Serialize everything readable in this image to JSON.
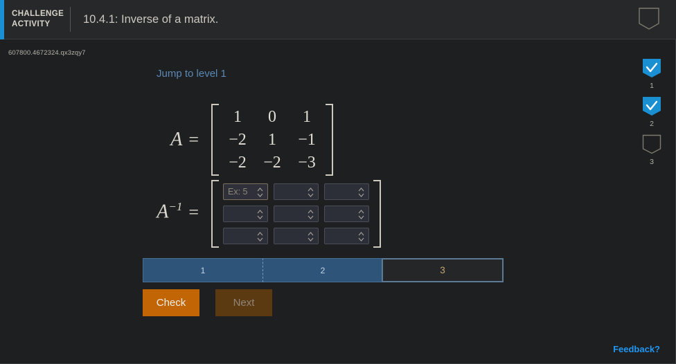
{
  "header": {
    "activity_label_line1": "CHALLENGE",
    "activity_label_line2": "ACTIVITY",
    "title": "10.4.1: Inverse of a matrix.",
    "shield_icon": "shield-outline-icon"
  },
  "content": {
    "question_id": "607800.4672324.qx3zqy7",
    "jump_link": "Jump to level 1"
  },
  "matrix_a": {
    "label": "A",
    "equals": "=",
    "rows": [
      [
        "1",
        "0",
        "1"
      ],
      [
        "−2",
        "1",
        "−1"
      ],
      [
        "−2",
        "−2",
        "−3"
      ]
    ]
  },
  "matrix_inverse": {
    "label": "A",
    "exponent": "−1",
    "equals": "=",
    "cells": [
      {
        "value": "",
        "placeholder": "Ex: 5",
        "focused": true
      },
      {
        "value": "",
        "placeholder": "",
        "focused": false
      },
      {
        "value": "",
        "placeholder": "",
        "focused": false
      },
      {
        "value": "",
        "placeholder": "",
        "focused": false
      },
      {
        "value": "",
        "placeholder": "",
        "focused": false
      },
      {
        "value": "",
        "placeholder": "",
        "focused": false
      },
      {
        "value": "",
        "placeholder": "",
        "focused": false
      },
      {
        "value": "",
        "placeholder": "",
        "focused": false
      },
      {
        "value": "",
        "placeholder": "",
        "focused": false
      }
    ]
  },
  "progress": {
    "segments": [
      {
        "label": "1",
        "state": "done"
      },
      {
        "label": "2",
        "state": "done"
      },
      {
        "label": "3",
        "state": "current"
      }
    ]
  },
  "buttons": {
    "check": "Check",
    "next": "Next"
  },
  "rail": {
    "items": [
      {
        "num": "1",
        "checked": true,
        "icon": "shield-check-icon"
      },
      {
        "num": "2",
        "checked": true,
        "icon": "shield-check-icon"
      },
      {
        "num": "3",
        "checked": false,
        "icon": "shield-outline-icon"
      }
    ]
  },
  "footer": {
    "feedback": "Feedback?"
  },
  "colors": {
    "page_bg": "#1d1f20",
    "header_bg": "#26282a",
    "accent_blue": "#1a8fd1",
    "progress_done": "#2e547a",
    "check_orange": "#c26504",
    "next_orange": "#5c3a11",
    "link_blue": "#5b89b5",
    "feedback_blue": "#2196f3",
    "current_gold": "#c2a876"
  }
}
